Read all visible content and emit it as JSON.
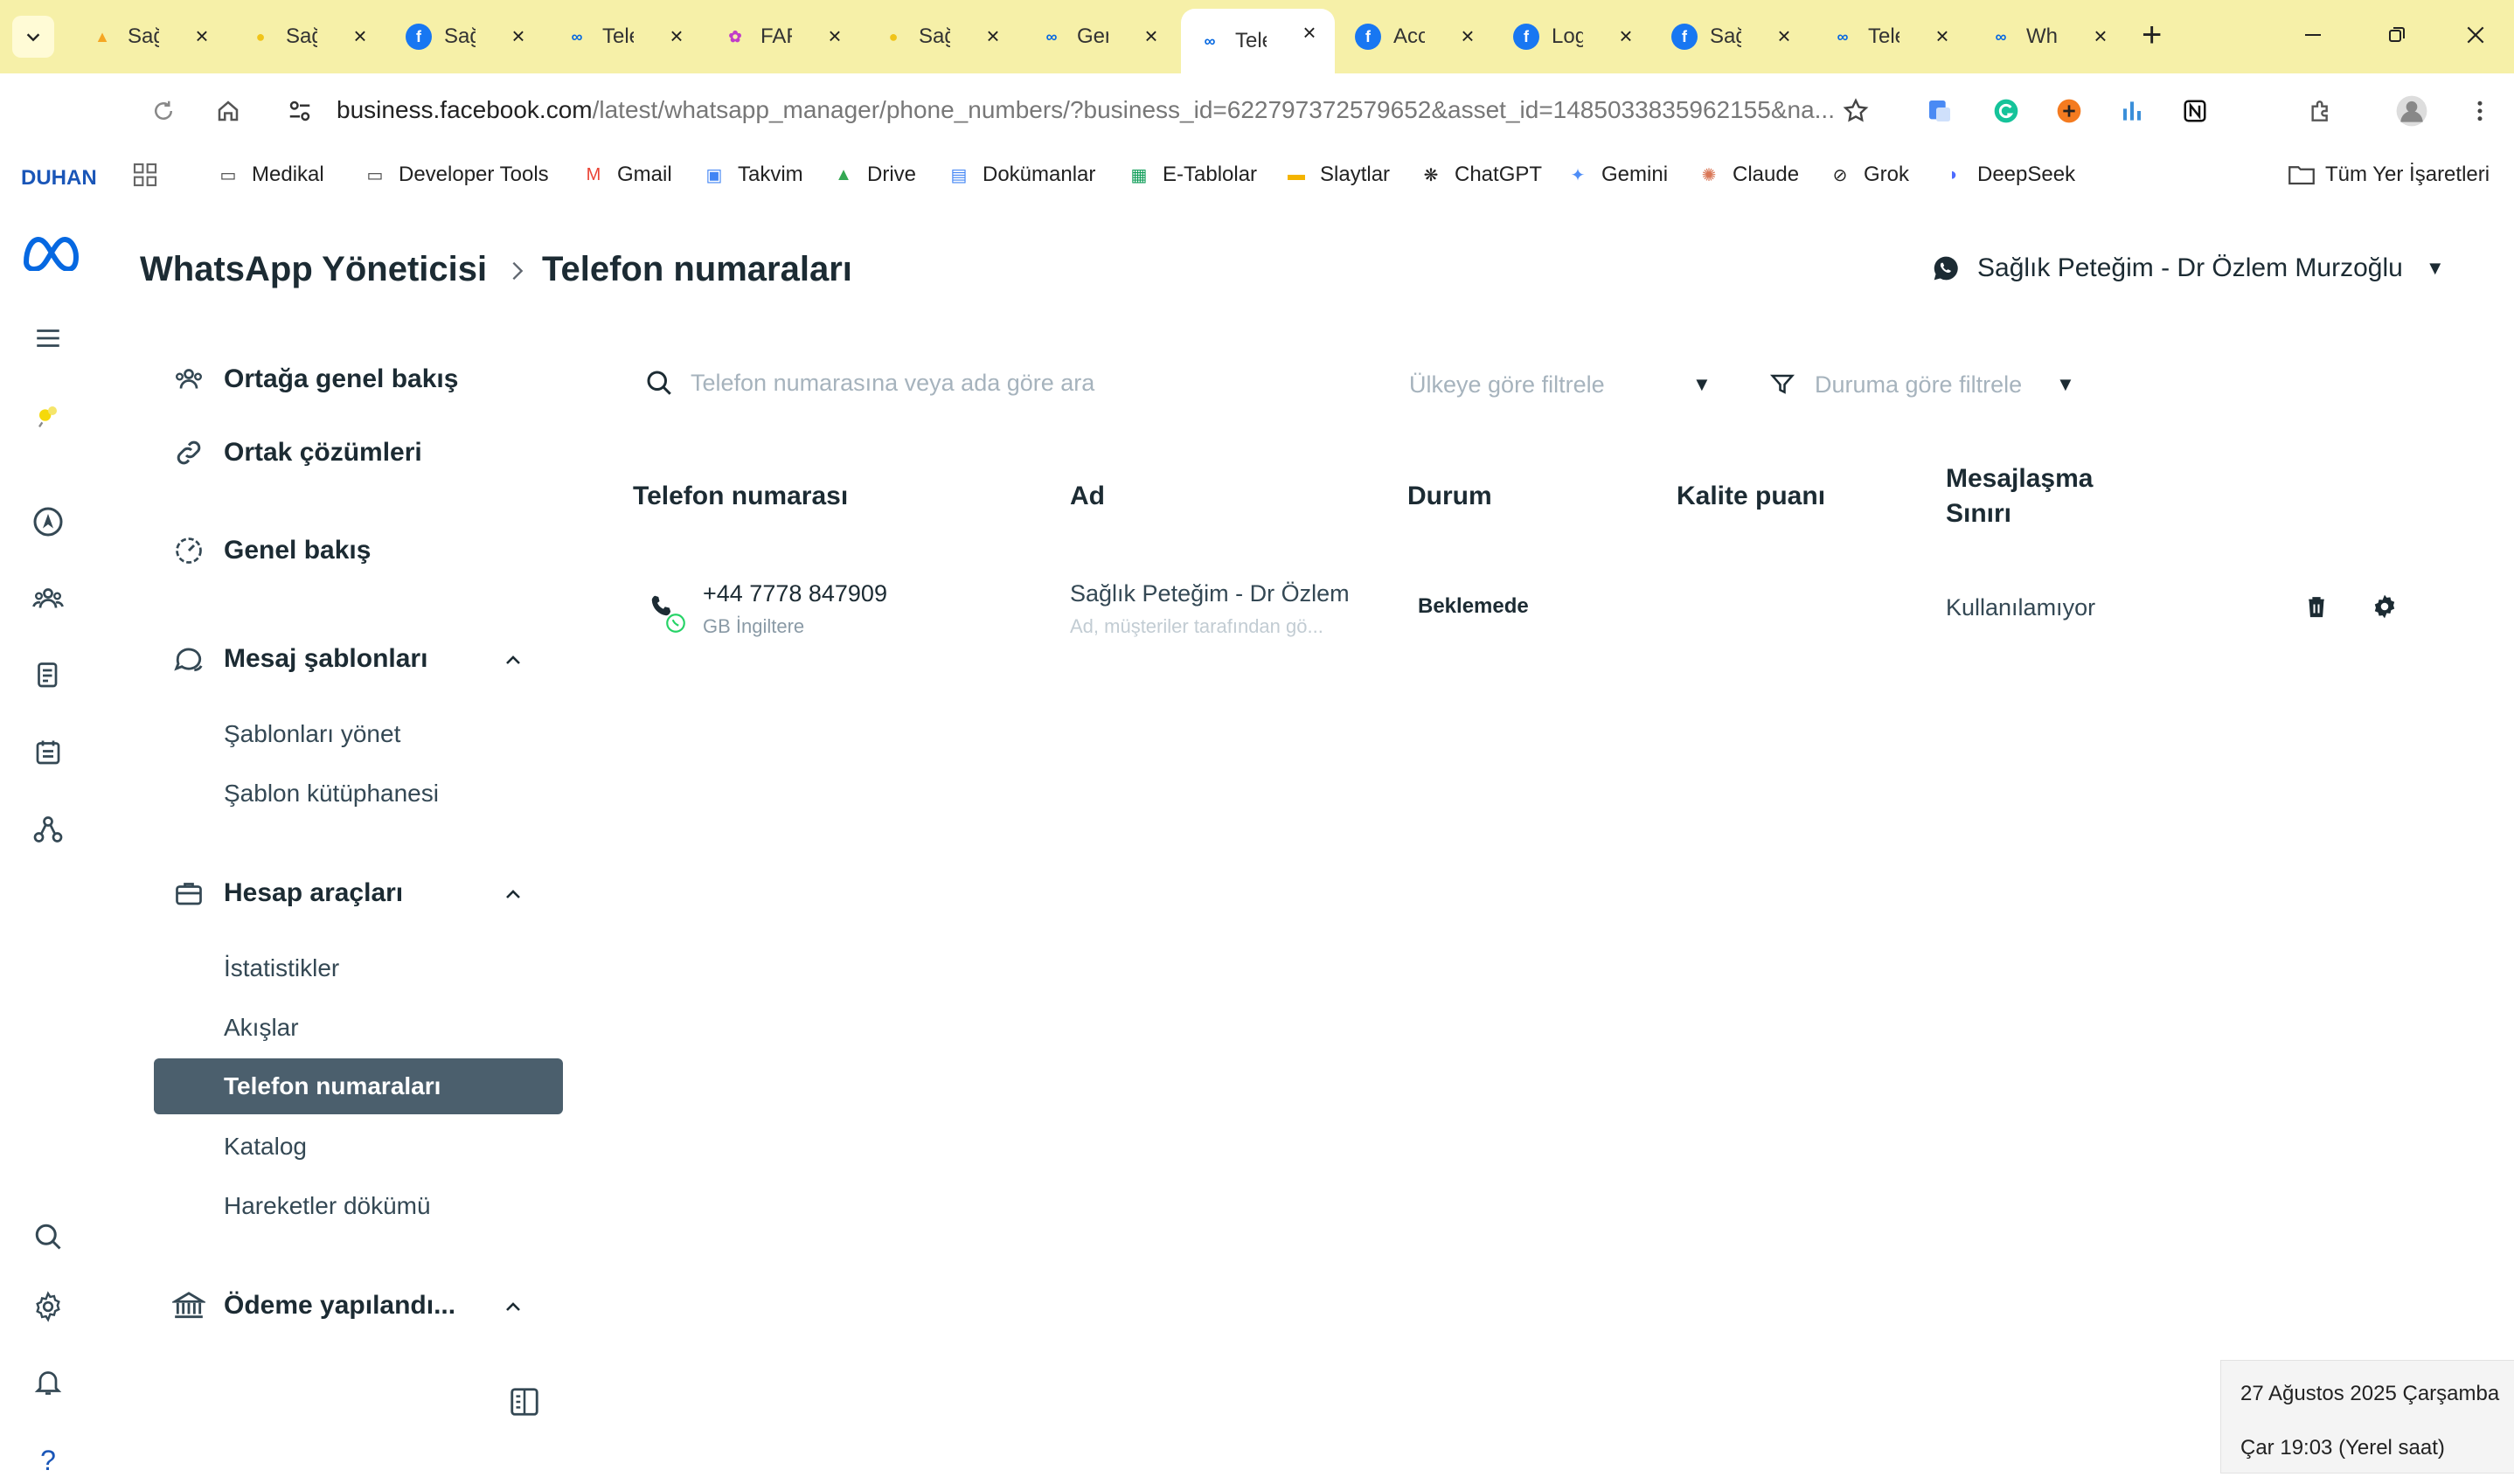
{
  "browser": {
    "tabs": [
      {
        "label": "Sağ",
        "icon": "fire-icon",
        "color": "#f5a623"
      },
      {
        "label": "Sağ",
        "icon": "bee-icon",
        "color": "#f0c419"
      },
      {
        "label": "Sağ",
        "icon": "facebook-icon",
        "color": "#1877f2"
      },
      {
        "label": "Tele",
        "icon": "meta-icon",
        "color": "#0668e1"
      },
      {
        "label": "FAF",
        "icon": "flower-icon",
        "color": "#c13ec9"
      },
      {
        "label": "Sağ",
        "icon": "bee-icon",
        "color": "#f0c419"
      },
      {
        "label": "Gen",
        "icon": "meta-icon",
        "color": "#0668e1"
      },
      {
        "label": "Tele",
        "icon": "meta-icon",
        "color": "#0668e1",
        "active": true
      },
      {
        "label": "Acc",
        "icon": "facebook-icon",
        "color": "#1877f2"
      },
      {
        "label": "Log",
        "icon": "facebook-icon",
        "color": "#1877f2"
      },
      {
        "label": "Sağ",
        "icon": "facebook-icon",
        "color": "#1877f2"
      },
      {
        "label": "Tele",
        "icon": "meta-icon",
        "color": "#0668e1"
      },
      {
        "label": "Wh",
        "icon": "meta-icon",
        "color": "#0668e1"
      }
    ],
    "url_host": "business.facebook.com",
    "url_path": "/latest/whatsapp_manager/phone_numbers/?business_id=622797372579652&asset_id=1485033835962155&na...",
    "profile_label": "DUHAN",
    "bookmarks": [
      {
        "label": "Medikal",
        "icon": "folder-icon"
      },
      {
        "label": "Developer Tools",
        "icon": "folder-icon"
      },
      {
        "label": "Gmail",
        "icon": "gmail-icon"
      },
      {
        "label": "Takvim",
        "icon": "calendar-icon"
      },
      {
        "label": "Drive",
        "icon": "drive-icon"
      },
      {
        "label": "Dokümanlar",
        "icon": "docs-icon"
      },
      {
        "label": "E-Tablolar",
        "icon": "sheets-icon"
      },
      {
        "label": "Slaytlar",
        "icon": "slides-icon"
      },
      {
        "label": "ChatGPT",
        "icon": "chatgpt-icon"
      },
      {
        "label": "Gemini",
        "icon": "gemini-icon"
      },
      {
        "label": "Claude",
        "icon": "claude-icon"
      },
      {
        "label": "Grok",
        "icon": "grok-icon"
      },
      {
        "label": "DeepSeek",
        "icon": "deepseek-icon"
      }
    ],
    "all_bookmarks_label": "Tüm Yer İşaretleri"
  },
  "header": {
    "breadcrumb_root": "WhatsApp Yöneticisi",
    "breadcrumb_current": "Telefon numaraları",
    "account_name": "Sağlık Peteğim - Dr Özlem Murzoğlu"
  },
  "sidebar": {
    "overview_partner": "Ortağa genel bakış",
    "partner_solutions": "Ortak çözümleri",
    "overview": "Genel bakış",
    "message_templates": "Mesaj şablonları",
    "manage_templates": "Şablonları yönet",
    "template_library": "Şablon kütüphanesi",
    "account_tools": "Hesap araçları",
    "statistics": "İstatistikler",
    "flows": "Akışlar",
    "phone_numbers": "Telefon numaraları",
    "catalog": "Katalog",
    "transactions": "Hareketler dökümü",
    "payment_setup": "Ödeme yapılandı..."
  },
  "filters": {
    "search_placeholder": "Telefon numarasına veya ada göre ara",
    "country_filter": "Ülkeye göre filtrele",
    "status_filter": "Duruma göre filtrele"
  },
  "table": {
    "columns": {
      "phone": "Telefon numarası",
      "name": "Ad",
      "status": "Durum",
      "quality": "Kalite puanı",
      "limit_line1": "Mesajlaşma",
      "limit_line2": "Sınırı"
    },
    "rows": [
      {
        "phone": "+44 7778 847909",
        "country": "GB İngiltere",
        "name": "Sağlık Peteğim - Dr Özlem",
        "name_note": "Ad, müşteriler tarafından gö...",
        "status": "Beklemede",
        "quality": "",
        "limit": "Kullanılamıyor"
      }
    ]
  },
  "taskbar_tooltip": {
    "date": "27 Ağustos 2025 Çarşamba",
    "time": "Çar 19:03 (Yerel saat)"
  },
  "colors": {
    "tab_bar": "#f6f0a8",
    "active_nav": "#4b5f6d",
    "meta_blue": "#0668e1",
    "text": "#1c2b33"
  }
}
